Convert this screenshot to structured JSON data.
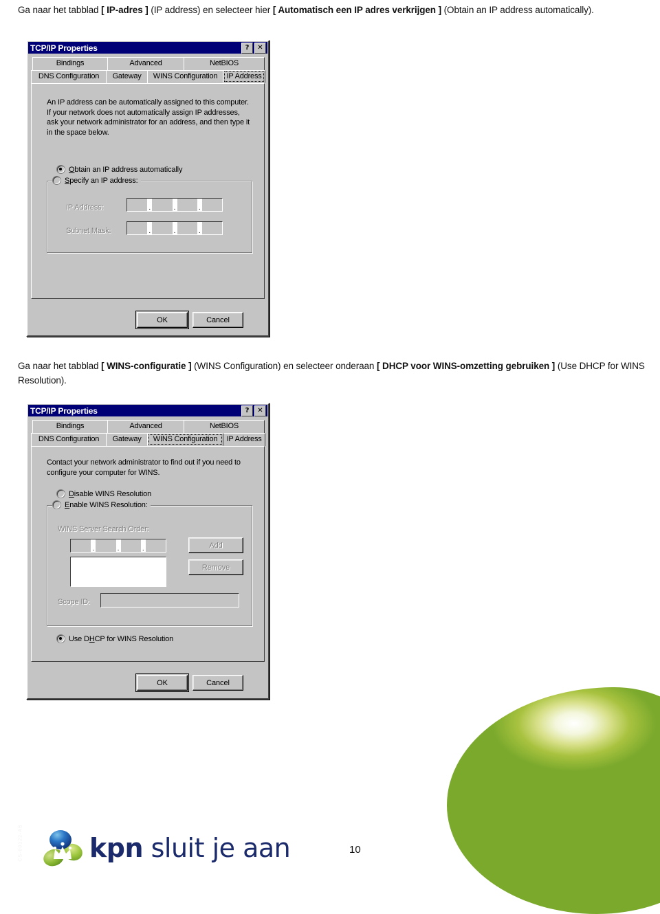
{
  "page": {
    "intro_text_parts": [
      {
        "t": "Ga naar het tabblad ",
        "b": false
      },
      {
        "t": "[ IP-adres ]",
        "b": true
      },
      {
        "t": " (IP address) en selecteer hier ",
        "b": false
      },
      {
        "t": "[ Automatisch een IP adres verkrijgen ]",
        "b": true
      },
      {
        "t": " (Obtain an IP address automatically).",
        "b": false
      }
    ],
    "mid_text_parts": [
      {
        "t": "Ga naar het tabblad ",
        "b": false
      },
      {
        "t": "[ WINS-configuratie ]",
        "b": true
      },
      {
        "t": " (WINS Configuration) en selecteer onderaan ",
        "b": false
      },
      {
        "t": "[ DHCP voor WINS-omzetting gebruiken ]",
        "b": true
      },
      {
        "t": " (Use DHCP for WINS Resolution).",
        "b": false
      }
    ],
    "page_number": "10",
    "side_code": "CS-00122-AB",
    "footer": {
      "logo_kpn": "kpn",
      "logo_tagline": " sluit je aan"
    },
    "colors": {
      "titlebar": "#000080",
      "dialog_face": "#c0c0c0",
      "brand_navy": "#1b2a6b",
      "brand_green": "#7faa2c"
    }
  },
  "dialog_ip": {
    "title": "TCP/IP Properties",
    "help_button": "?",
    "close_button": "✕",
    "tabs_row_top": [
      {
        "label": "Bindings",
        "active": false
      },
      {
        "label": "Advanced",
        "active": false
      },
      {
        "label": "NetBIOS",
        "active": false
      }
    ],
    "tabs_row_bottom": [
      {
        "label": "DNS Configuration",
        "active": false
      },
      {
        "label": "Gateway",
        "active": false
      },
      {
        "label": "WINS Configuration",
        "active": false
      },
      {
        "label": "IP Address",
        "active": true
      }
    ],
    "description": "An IP address can be automatically assigned to this computer. If your network does not automatically assign IP addresses, ask your network administrator for an address, and then type it in the space below.",
    "radio_obtain": {
      "label": "Obtain an IP address automatically",
      "accel": "O",
      "checked": true
    },
    "radio_specify": {
      "label": "Specify an IP address:",
      "accel": "S",
      "checked": false
    },
    "field_ip_label": "IP Address:",
    "field_subnet_label": "Subnet Mask:",
    "ip_value": "",
    "subnet_value": "",
    "button_ok": "OK",
    "button_cancel": "Cancel"
  },
  "dialog_wins": {
    "title": "TCP/IP Properties",
    "help_button": "?",
    "close_button": "✕",
    "tabs_row_top": [
      {
        "label": "Bindings",
        "active": false
      },
      {
        "label": "Advanced",
        "active": false
      },
      {
        "label": "NetBIOS",
        "active": false
      }
    ],
    "tabs_row_bottom": [
      {
        "label": "DNS Configuration",
        "active": false
      },
      {
        "label": "Gateway",
        "active": false
      },
      {
        "label": "WINS Configuration",
        "active": true
      },
      {
        "label": "IP Address",
        "active": false
      }
    ],
    "description": "Contact your network administrator to find out if you need to configure your computer for WINS.",
    "radio_disable": {
      "label": "Disable WINS Resolution",
      "accel": "D",
      "checked": false
    },
    "radio_enable": {
      "label": "Enable WINS Resolution:",
      "accel": "E",
      "checked": false
    },
    "radio_use_dhcp": {
      "label": "Use DHCP for WINS Resolution",
      "accel": "H",
      "checked": true
    },
    "search_order_label": "WINS Server Search Order:",
    "search_order_value": "",
    "server_list_items": [],
    "scope_id_label": "Scope ID:",
    "scope_id_value": "",
    "button_add": "Add",
    "button_remove": "Remove",
    "button_ok": "OK",
    "button_cancel": "Cancel"
  }
}
